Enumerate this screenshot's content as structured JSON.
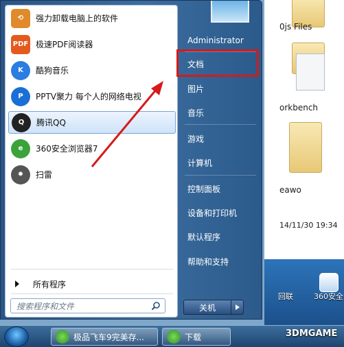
{
  "start_menu": {
    "programs": [
      {
        "label": "强力卸载电脑上的软件",
        "icon": "uninstall-icon",
        "color": "#e08a2b"
      },
      {
        "label": "极速PDF阅读器",
        "icon": "pdf-icon",
        "color": "#e45a1e",
        "icon_text": "PDF"
      },
      {
        "label": "酷狗音乐",
        "icon": "kugou-icon",
        "color": "#2a7de1",
        "icon_text": "K"
      },
      {
        "label": "PPTV聚力 每个人的网络电视",
        "icon": "pptv-icon",
        "color": "#1a6fd6",
        "icon_text": "P"
      },
      {
        "label": "腾讯QQ",
        "icon": "qq-icon",
        "color": "#222222",
        "icon_text": "Q",
        "selected": true
      },
      {
        "label": "360安全浏览器7",
        "icon": "browser-360-icon",
        "color": "#3aa43a",
        "icon_text": "e"
      },
      {
        "label": "扫雷",
        "icon": "minesweeper-icon",
        "color": "#555555",
        "icon_text": "✹"
      }
    ],
    "all_programs": "所有程序",
    "search_placeholder": "搜索程序和文件",
    "right_items": [
      "Administrator",
      "文档",
      "图片",
      "音乐",
      "游戏",
      "计算机",
      "控制面板",
      "设备和打印机",
      "默认程序",
      "帮助和支持"
    ],
    "shutdown": "关机"
  },
  "background": {
    "explorer_items": [
      "0js Files",
      "orkbench",
      "eawo",
      "14/11/30 19:34"
    ],
    "desktop_items": [
      "回联",
      "360安全..."
    ]
  },
  "taskbar": {
    "buttons": [
      "极品飞车9完美存...",
      "下载"
    ],
    "watermark": "3DMGAME"
  },
  "colors": {
    "highlight": "#d61a1a",
    "arrow": "#d61a1a"
  }
}
